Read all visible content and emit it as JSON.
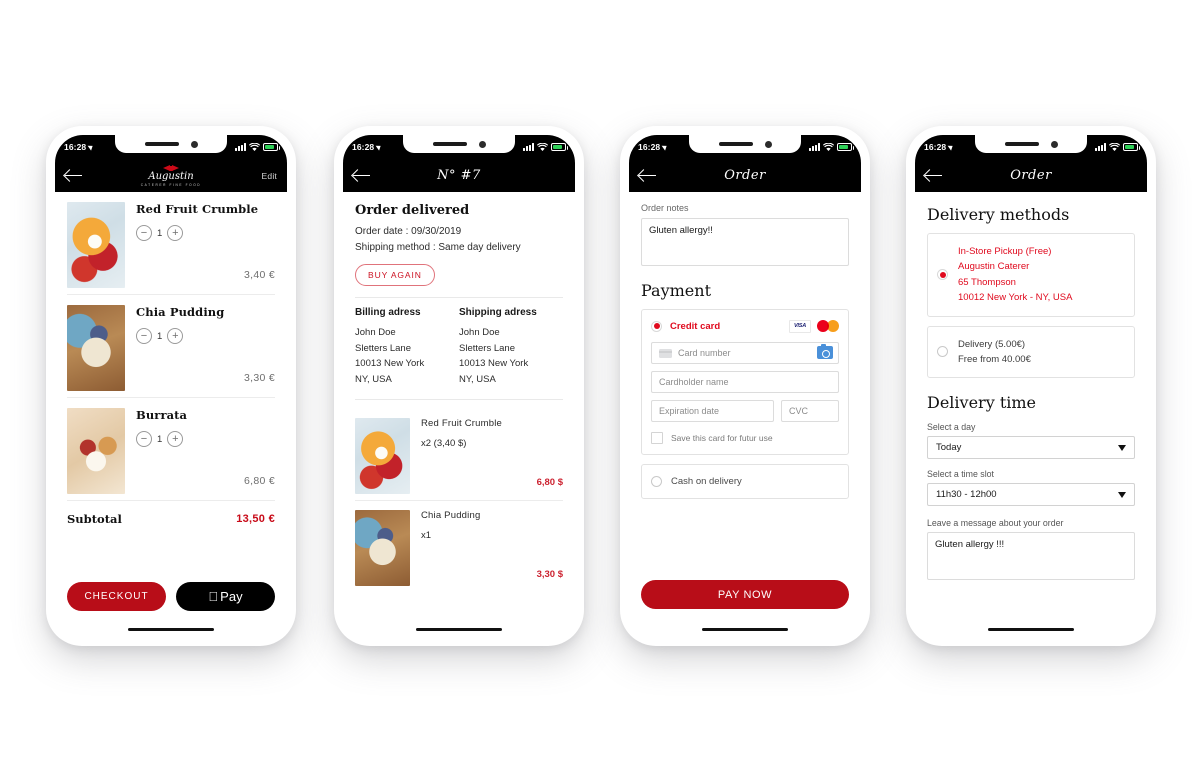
{
  "status_bar": {
    "time": "16:28",
    "location_icon": "location-arrow-icon",
    "signal_icon": "signal-bars-icon",
    "wifi_icon": "wifi-icon",
    "battery_icon": "battery-icon"
  },
  "phones": [
    {
      "id": "cart",
      "nav": {
        "back_icon": "back-arrow-icon",
        "logo_word": "Augustin",
        "logo_sub": "CATERER  FINE FOOD",
        "edit_label": "Edit"
      },
      "items": [
        {
          "name": "Red Fruit Crumble",
          "qty": "1",
          "price": "3,40 €",
          "thumb": "crumble",
          "minus": "−",
          "plus": "+"
        },
        {
          "name": "Chia Pudding",
          "qty": "1",
          "price": "3,30 €",
          "thumb": "chia",
          "minus": "−",
          "plus": "+"
        },
        {
          "name": "Burrata",
          "qty": "1",
          "price": "6,80 €",
          "thumb": "burrata",
          "minus": "−",
          "plus": "+"
        }
      ],
      "subtotal_label": "Subtotal",
      "subtotal_value": "13,50 €",
      "checkout_label": "CHECKOUT",
      "apple_pay_label": "Pay",
      "apple_logo": "apple-logo-icon"
    },
    {
      "id": "order-detail",
      "nav": {
        "back_icon": "back-arrow-icon",
        "title": "N° #7"
      },
      "heading": "Order delivered",
      "order_date": "Order date : 09/30/2019",
      "shipping_method": "Shipping method : Same day delivery",
      "buy_again_label": "BUY AGAIN",
      "billing": {
        "header": "Billing adress",
        "lines": [
          "John Doe",
          "Sletters Lane",
          "10013 New York",
          "NY, USA"
        ]
      },
      "shipping": {
        "header": "Shipping adress",
        "lines": [
          "John Doe",
          "Sletters Lane",
          "10013 New York",
          "NY, USA"
        ]
      },
      "lines": [
        {
          "name": "Red Fruit Crumble",
          "qty": "x2 (3,40 $)",
          "price": "6,80 $",
          "thumb": "crumble"
        },
        {
          "name": "Chia Pudding",
          "qty": "x1",
          "price": "3,30 $",
          "thumb": "chia"
        }
      ]
    },
    {
      "id": "payment",
      "nav": {
        "back_icon": "back-arrow-icon",
        "title": "Order"
      },
      "notes_label": "Order notes",
      "notes_value": "Gluten allergy!!",
      "payment_title": "Payment",
      "credit_card": {
        "label": "Credit card",
        "visa_icon": "visa-logo-icon",
        "mastercard_icon": "mastercard-logo-icon",
        "card_number_placeholder": "Card number",
        "card_icon": "credit-card-icon",
        "scan_icon": "camera-scan-icon",
        "cardholder_placeholder": "Cardholder name",
        "expiration_placeholder": "Expiration date",
        "cvc_placeholder": "CVC",
        "save_card_label": "Save this card for futur use"
      },
      "cash_label": "Cash on delivery",
      "pay_now_label": "PAY NOW"
    },
    {
      "id": "delivery",
      "nav": {
        "back_icon": "back-arrow-icon",
        "title": "Order"
      },
      "methods_title": "Delivery methods",
      "method_pickup": [
        "In-Store Pickup (Free)",
        "Augustin Caterer",
        "65 Thompson",
        "10012 New York - NY, USA"
      ],
      "method_delivery": [
        "Delivery (5.00€)",
        "Free from 40.00€"
      ],
      "time_title": "Delivery time",
      "day_label": "Select a day",
      "day_value": "Today",
      "slot_label": "Select a time slot",
      "slot_value": "11h30 - 12h00",
      "message_label": "Leave a message about your order",
      "message_value": "Gluten allergy !!!"
    }
  ],
  "colors": {
    "brand_red": "#b80d18",
    "accent_red": "#e00a1e",
    "black": "#000000"
  }
}
